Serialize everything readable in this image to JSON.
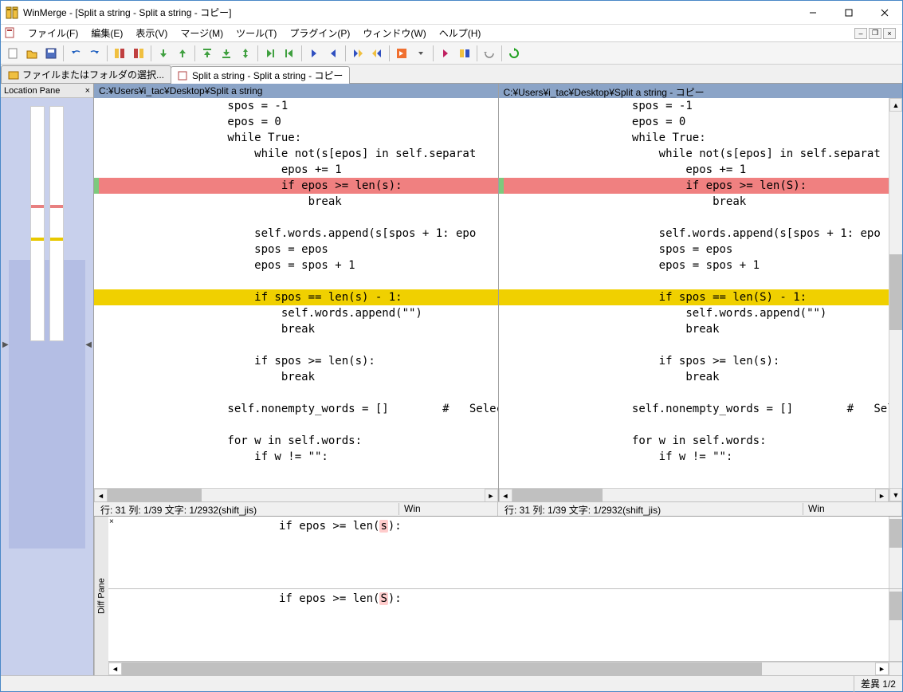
{
  "app": {
    "title": "WinMerge - [Split a string - Split a string - コピー]"
  },
  "menu": {
    "file": "ファイル(F)",
    "edit": "編集(E)",
    "view": "表示(V)",
    "merge": "マージ(M)",
    "tools": "ツール(T)",
    "plugins": "プラグイン(P)",
    "window": "ウィンドウ(W)",
    "help": "ヘルプ(H)"
  },
  "tabs": {
    "tab1": "ファイルまたはフォルダの選択...",
    "tab2": "Split a string - Split a string - コピー"
  },
  "location_pane": {
    "title": "Location Pane"
  },
  "left": {
    "path": "C:¥Users¥i_tac¥Desktop¥Split a string",
    "lines": [
      "        spos = -1",
      "        epos = 0",
      "        while True:",
      "            while not(s[epos] in self.separat",
      "                epos += 1",
      "                if epos >= len(s):",
      "                    break",
      "",
      "            self.words.append(s[spos + 1: epo",
      "            spos = epos",
      "            epos = spos + 1",
      "",
      "            if spos == len(s) - 1:",
      "                self.words.append(\"\")",
      "                break",
      "",
      "            if spos >= len(s):",
      "                break",
      "",
      "        self.nonempty_words = []        #   Selec",
      "",
      "        for w in self.words:",
      "            if w != \"\":"
    ],
    "status_main": "行: 31  列: 1/39  文字: 1/2932(shift_jis)",
    "status_sub": "Win"
  },
  "right": {
    "path": "C:¥Users¥i_tac¥Desktop¥Split a string - コピー",
    "lines": [
      "        spos = -1",
      "        epos = 0",
      "        while True:",
      "            while not(s[epos] in self.separat",
      "                epos += 1",
      "                if epos >= len(S):",
      "                    break",
      "",
      "            self.words.append(s[spos + 1: epo",
      "            spos = epos",
      "            epos = spos + 1",
      "",
      "            if spos == len(S) - 1:",
      "                self.words.append(\"\")",
      "                break",
      "",
      "            if spos >= len(s):",
      "                break",
      "",
      "        self.nonempty_words = []        #   Selec",
      "",
      "        for w in self.words:",
      "            if w != \"\":"
    ],
    "status_main": "行: 31  列: 1/39  文字: 1/2932(shift_jis)",
    "status_sub": "Win"
  },
  "diff_detail": {
    "label": "Diff Pane",
    "line1_pre": "if epos >= len(",
    "line1_hl": "s",
    "line1_post": "):",
    "line2_pre": "if epos >= len(",
    "line2_hl": "S",
    "line2_post": "):"
  },
  "bottom_status": {
    "diff": "差異 1/2"
  },
  "diff_line_styles": {
    "5": "diff-red",
    "12": "diff-yellow"
  }
}
